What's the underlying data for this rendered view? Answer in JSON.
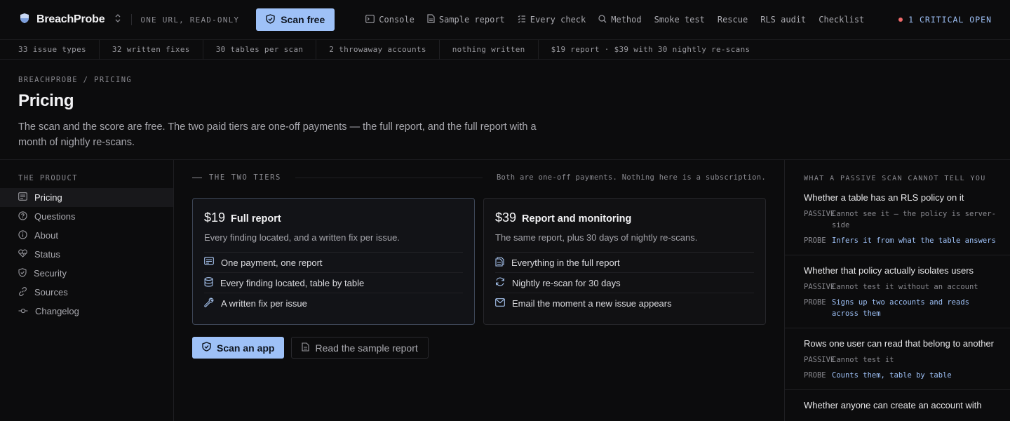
{
  "brand": {
    "name": "BreachProbe",
    "tagline": "ONE URL, READ-ONLY"
  },
  "header_cta": {
    "label": "Scan free"
  },
  "nav": [
    {
      "label": "Console",
      "icon": "terminal-icon"
    },
    {
      "label": "Sample report",
      "icon": "file-icon"
    },
    {
      "label": "Every check",
      "icon": "checklist-icon"
    },
    {
      "label": "Method",
      "icon": "search-icon"
    },
    {
      "label": "Smoke test",
      "icon": ""
    },
    {
      "label": "Rescue",
      "icon": ""
    },
    {
      "label": "RLS audit",
      "icon": ""
    },
    {
      "label": "Checklist",
      "icon": ""
    }
  ],
  "status": {
    "label": "1 CRITICAL OPEN",
    "dot_color": "#f06a6a"
  },
  "stats": [
    "33 issue types",
    "32 written fixes",
    "30 tables per scan",
    "2 throwaway accounts",
    "nothing written",
    "$19 report · $39 with 30 nightly re-scans"
  ],
  "page": {
    "breadcrumb": "BREACHPROBE / PRICING",
    "title": "Pricing",
    "lead": "The scan and the score are free. The two paid tiers are one-off payments — the full report, and the full report with a month of nightly re-scans."
  },
  "sidebar": {
    "heading": "THE PRODUCT",
    "items": [
      {
        "label": "Pricing",
        "icon": "receipt-icon",
        "active": true
      },
      {
        "label": "Questions",
        "icon": "question-icon",
        "active": false
      },
      {
        "label": "About",
        "icon": "info-icon",
        "active": false
      },
      {
        "label": "Status",
        "icon": "heartbeat-icon",
        "active": false
      },
      {
        "label": "Security",
        "icon": "shield-icon",
        "active": false
      },
      {
        "label": "Sources",
        "icon": "link-icon",
        "active": false
      },
      {
        "label": "Changelog",
        "icon": "commit-icon",
        "active": false
      }
    ]
  },
  "tiers_section": {
    "title": "THE TWO TIERS",
    "note": "Both are one-off payments. Nothing here is a subscription.",
    "tiers": [
      {
        "price": "$19",
        "name": "Full report",
        "desc": "Every finding located, and a written fix per issue.",
        "features": [
          {
            "label": "One payment, one report",
            "icon": "receipt-icon"
          },
          {
            "label": "Every finding located, table by table",
            "icon": "database-icon"
          },
          {
            "label": "A written fix per issue",
            "icon": "wrench-icon"
          }
        ]
      },
      {
        "price": "$39",
        "name": "Report and monitoring",
        "desc": "The same report, plus 30 days of nightly re-scans.",
        "features": [
          {
            "label": "Everything in the full report",
            "icon": "files-icon"
          },
          {
            "label": "Nightly re-scan for 30 days",
            "icon": "refresh-icon"
          },
          {
            "label": "Email the moment a new issue appears",
            "icon": "mail-icon"
          }
        ]
      }
    ],
    "primary_cta": "Scan an app",
    "secondary_cta": "Read the sample report"
  },
  "aside": {
    "heading": "WHAT A PASSIVE SCAN CANNOT TELL YOU",
    "passive_label": "PASSIVE",
    "probe_label": "PROBE",
    "items": [
      {
        "title": "Whether a table has an RLS policy on it",
        "passive": "Cannot see it — the policy is server-side",
        "probe": "Infers it from what the table answers"
      },
      {
        "title": "Whether that policy actually isolates users",
        "passive": "Cannot test it without an account",
        "probe": "Signs up two accounts and reads across them"
      },
      {
        "title": "Rows one user can read that belong to another",
        "passive": "Cannot test it",
        "probe": "Counts them, table by table"
      },
      {
        "title": "Whether anyone can create an account with",
        "passive": "",
        "probe": ""
      }
    ]
  }
}
